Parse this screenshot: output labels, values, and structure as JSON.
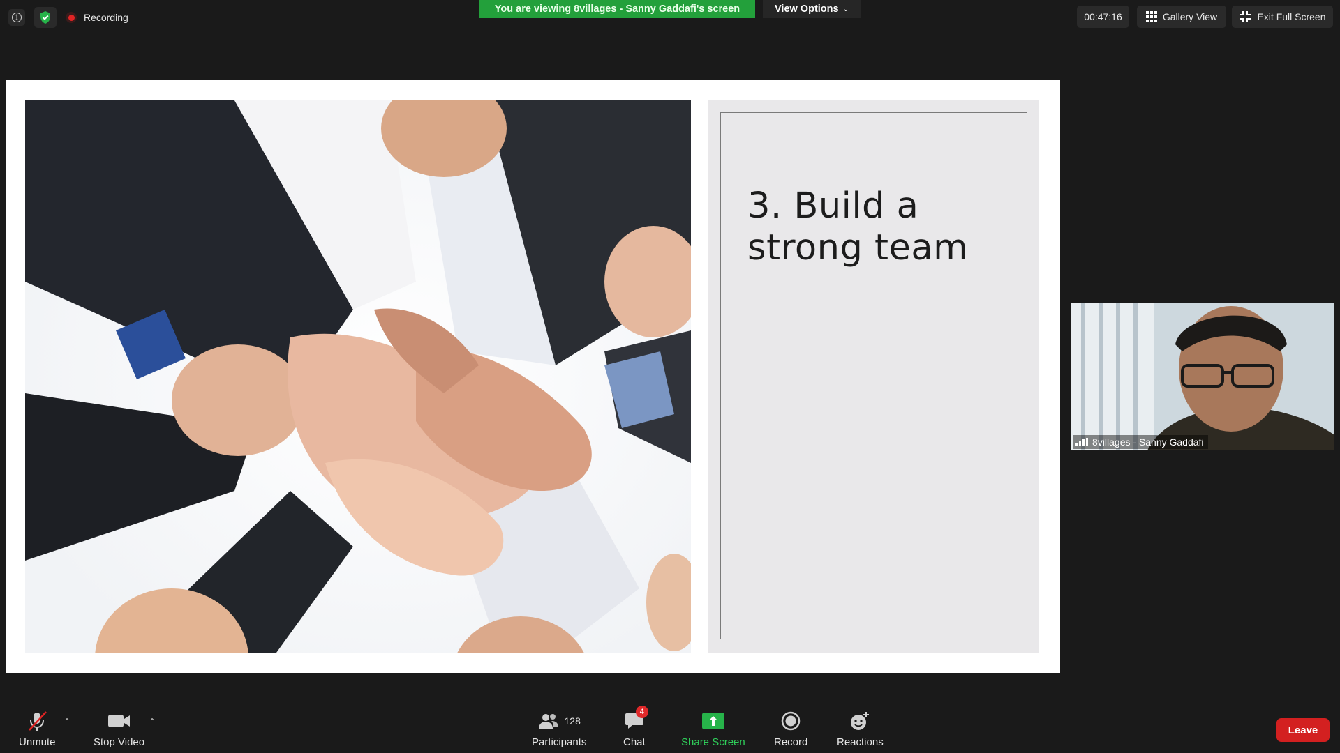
{
  "top_bar": {
    "recording_label": "Recording",
    "viewing_banner": "You are viewing 8villages - Sanny Gaddafi's screen",
    "view_options_label": "View Options",
    "timer": "00:47:16",
    "gallery_view_label": "Gallery View",
    "exit_full_screen_label": "Exit Full Screen"
  },
  "slide": {
    "title_line1": "3. Build a",
    "title_line2": "strong team"
  },
  "participant": {
    "name": "8villages - Sanny Gaddafi"
  },
  "toolbar": {
    "unmute_label": "Unmute",
    "stop_video_label": "Stop Video",
    "participants_label": "Participants",
    "participants_count": "128",
    "chat_label": "Chat",
    "chat_badge": "4",
    "share_screen_label": "Share Screen",
    "record_label": "Record",
    "reactions_label": "Reactions",
    "leave_label": "Leave"
  },
  "colors": {
    "background": "#1a1a1a",
    "banner_green": "#23a03b",
    "share_green": "#2fd05a",
    "leave_red": "#d32020",
    "recording_red": "#e02424"
  },
  "icons": [
    "info-icon",
    "shield-check-icon",
    "recording-dot-icon",
    "chevron-down-icon",
    "grid-icon",
    "exit-fullscreen-icon",
    "muted-mic-icon",
    "video-camera-icon",
    "participants-icon",
    "chat-icon",
    "share-screen-icon",
    "record-icon",
    "reactions-icon",
    "signal-strength-icon"
  ]
}
